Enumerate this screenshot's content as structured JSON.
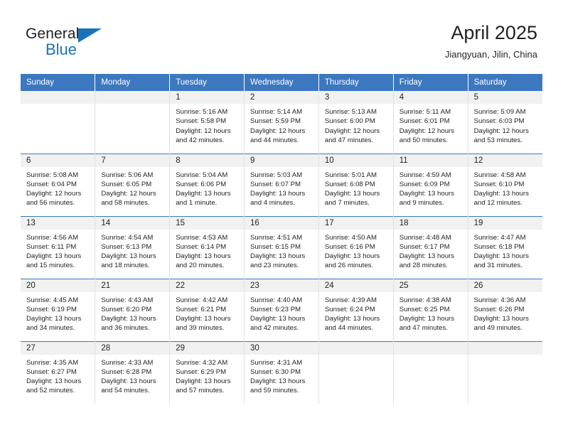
{
  "brand": {
    "name_part1": "General",
    "name_part2": "Blue",
    "triangle_icon": "blue-triangle-icon",
    "accent_color": "#1b72b8"
  },
  "header": {
    "title": "April 2025",
    "location": "Jiangyuan, Jilin, China"
  },
  "calendar": {
    "header_bg": "#3b78c0",
    "daynum_band_bg": "#f1f1f1",
    "weekdays": [
      "Sunday",
      "Monday",
      "Tuesday",
      "Wednesday",
      "Thursday",
      "Friday",
      "Saturday"
    ],
    "labels": {
      "sunrise": "Sunrise:",
      "sunset": "Sunset:",
      "daylight": "Daylight:"
    },
    "weeks": [
      [
        {
          "day": ""
        },
        {
          "day": ""
        },
        {
          "day": "1",
          "sunrise": "Sunrise: 5:16 AM",
          "sunset": "Sunset: 5:58 PM",
          "daylight_l1": "Daylight: 12 hours",
          "daylight_l2": "and 42 minutes."
        },
        {
          "day": "2",
          "sunrise": "Sunrise: 5:14 AM",
          "sunset": "Sunset: 5:59 PM",
          "daylight_l1": "Daylight: 12 hours",
          "daylight_l2": "and 44 minutes."
        },
        {
          "day": "3",
          "sunrise": "Sunrise: 5:13 AM",
          "sunset": "Sunset: 6:00 PM",
          "daylight_l1": "Daylight: 12 hours",
          "daylight_l2": "and 47 minutes."
        },
        {
          "day": "4",
          "sunrise": "Sunrise: 5:11 AM",
          "sunset": "Sunset: 6:01 PM",
          "daylight_l1": "Daylight: 12 hours",
          "daylight_l2": "and 50 minutes."
        },
        {
          "day": "5",
          "sunrise": "Sunrise: 5:09 AM",
          "sunset": "Sunset: 6:03 PM",
          "daylight_l1": "Daylight: 12 hours",
          "daylight_l2": "and 53 minutes."
        }
      ],
      [
        {
          "day": "6",
          "sunrise": "Sunrise: 5:08 AM",
          "sunset": "Sunset: 6:04 PM",
          "daylight_l1": "Daylight: 12 hours",
          "daylight_l2": "and 56 minutes."
        },
        {
          "day": "7",
          "sunrise": "Sunrise: 5:06 AM",
          "sunset": "Sunset: 6:05 PM",
          "daylight_l1": "Daylight: 12 hours",
          "daylight_l2": "and 58 minutes."
        },
        {
          "day": "8",
          "sunrise": "Sunrise: 5:04 AM",
          "sunset": "Sunset: 6:06 PM",
          "daylight_l1": "Daylight: 13 hours",
          "daylight_l2": "and 1 minute."
        },
        {
          "day": "9",
          "sunrise": "Sunrise: 5:03 AM",
          "sunset": "Sunset: 6:07 PM",
          "daylight_l1": "Daylight: 13 hours",
          "daylight_l2": "and 4 minutes."
        },
        {
          "day": "10",
          "sunrise": "Sunrise: 5:01 AM",
          "sunset": "Sunset: 6:08 PM",
          "daylight_l1": "Daylight: 13 hours",
          "daylight_l2": "and 7 minutes."
        },
        {
          "day": "11",
          "sunrise": "Sunrise: 4:59 AM",
          "sunset": "Sunset: 6:09 PM",
          "daylight_l1": "Daylight: 13 hours",
          "daylight_l2": "and 9 minutes."
        },
        {
          "day": "12",
          "sunrise": "Sunrise: 4:58 AM",
          "sunset": "Sunset: 6:10 PM",
          "daylight_l1": "Daylight: 13 hours",
          "daylight_l2": "and 12 minutes."
        }
      ],
      [
        {
          "day": "13",
          "sunrise": "Sunrise: 4:56 AM",
          "sunset": "Sunset: 6:11 PM",
          "daylight_l1": "Daylight: 13 hours",
          "daylight_l2": "and 15 minutes."
        },
        {
          "day": "14",
          "sunrise": "Sunrise: 4:54 AM",
          "sunset": "Sunset: 6:13 PM",
          "daylight_l1": "Daylight: 13 hours",
          "daylight_l2": "and 18 minutes."
        },
        {
          "day": "15",
          "sunrise": "Sunrise: 4:53 AM",
          "sunset": "Sunset: 6:14 PM",
          "daylight_l1": "Daylight: 13 hours",
          "daylight_l2": "and 20 minutes."
        },
        {
          "day": "16",
          "sunrise": "Sunrise: 4:51 AM",
          "sunset": "Sunset: 6:15 PM",
          "daylight_l1": "Daylight: 13 hours",
          "daylight_l2": "and 23 minutes."
        },
        {
          "day": "17",
          "sunrise": "Sunrise: 4:50 AM",
          "sunset": "Sunset: 6:16 PM",
          "daylight_l1": "Daylight: 13 hours",
          "daylight_l2": "and 26 minutes."
        },
        {
          "day": "18",
          "sunrise": "Sunrise: 4:48 AM",
          "sunset": "Sunset: 6:17 PM",
          "daylight_l1": "Daylight: 13 hours",
          "daylight_l2": "and 28 minutes."
        },
        {
          "day": "19",
          "sunrise": "Sunrise: 4:47 AM",
          "sunset": "Sunset: 6:18 PM",
          "daylight_l1": "Daylight: 13 hours",
          "daylight_l2": "and 31 minutes."
        }
      ],
      [
        {
          "day": "20",
          "sunrise": "Sunrise: 4:45 AM",
          "sunset": "Sunset: 6:19 PM",
          "daylight_l1": "Daylight: 13 hours",
          "daylight_l2": "and 34 minutes."
        },
        {
          "day": "21",
          "sunrise": "Sunrise: 4:43 AM",
          "sunset": "Sunset: 6:20 PM",
          "daylight_l1": "Daylight: 13 hours",
          "daylight_l2": "and 36 minutes."
        },
        {
          "day": "22",
          "sunrise": "Sunrise: 4:42 AM",
          "sunset": "Sunset: 6:21 PM",
          "daylight_l1": "Daylight: 13 hours",
          "daylight_l2": "and 39 minutes."
        },
        {
          "day": "23",
          "sunrise": "Sunrise: 4:40 AM",
          "sunset": "Sunset: 6:23 PM",
          "daylight_l1": "Daylight: 13 hours",
          "daylight_l2": "and 42 minutes."
        },
        {
          "day": "24",
          "sunrise": "Sunrise: 4:39 AM",
          "sunset": "Sunset: 6:24 PM",
          "daylight_l1": "Daylight: 13 hours",
          "daylight_l2": "and 44 minutes."
        },
        {
          "day": "25",
          "sunrise": "Sunrise: 4:38 AM",
          "sunset": "Sunset: 6:25 PM",
          "daylight_l1": "Daylight: 13 hours",
          "daylight_l2": "and 47 minutes."
        },
        {
          "day": "26",
          "sunrise": "Sunrise: 4:36 AM",
          "sunset": "Sunset: 6:26 PM",
          "daylight_l1": "Daylight: 13 hours",
          "daylight_l2": "and 49 minutes."
        }
      ],
      [
        {
          "day": "27",
          "sunrise": "Sunrise: 4:35 AM",
          "sunset": "Sunset: 6:27 PM",
          "daylight_l1": "Daylight: 13 hours",
          "daylight_l2": "and 52 minutes."
        },
        {
          "day": "28",
          "sunrise": "Sunrise: 4:33 AM",
          "sunset": "Sunset: 6:28 PM",
          "daylight_l1": "Daylight: 13 hours",
          "daylight_l2": "and 54 minutes."
        },
        {
          "day": "29",
          "sunrise": "Sunrise: 4:32 AM",
          "sunset": "Sunset: 6:29 PM",
          "daylight_l1": "Daylight: 13 hours",
          "daylight_l2": "and 57 minutes."
        },
        {
          "day": "30",
          "sunrise": "Sunrise: 4:31 AM",
          "sunset": "Sunset: 6:30 PM",
          "daylight_l1": "Daylight: 13 hours",
          "daylight_l2": "and 59 minutes."
        },
        {
          "day": ""
        },
        {
          "day": ""
        },
        {
          "day": ""
        }
      ]
    ]
  }
}
